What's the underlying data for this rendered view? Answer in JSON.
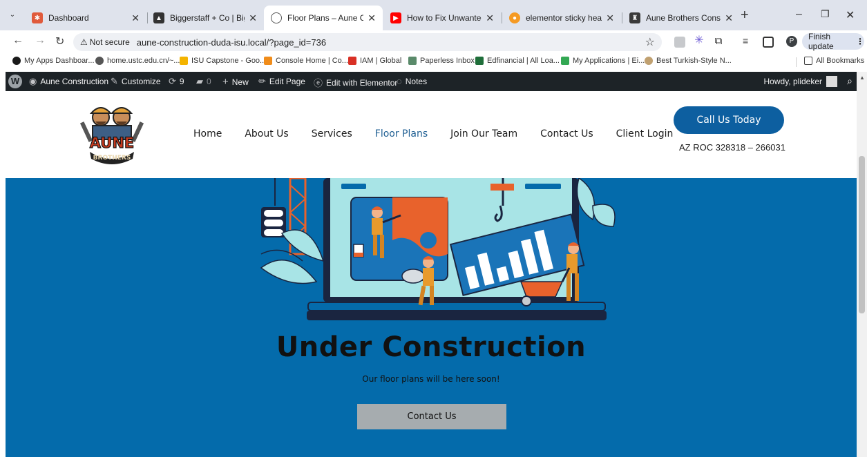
{
  "browser": {
    "tabs": [
      {
        "title": "Dashboard",
        "favicon_color": "#e05a3b",
        "active": false
      },
      {
        "title": "Biggerstaff + Co | Big Sky",
        "favicon_color": "#333333",
        "active": false
      },
      {
        "title": "Floor Plans – Aune Constru",
        "favicon_color": "#555555",
        "active": true
      },
      {
        "title": "How to Fix Unwanted Hori",
        "favicon_color": "#ff0000",
        "active": false
      },
      {
        "title": "elementor sticky header or",
        "favicon_color": "#f59a23",
        "active": false
      },
      {
        "title": "Aune Brothers Constructio",
        "favicon_color": "#3a3a3a",
        "active": false
      }
    ],
    "security_label": "Not secure",
    "url": "aune-construction-duda-isu.local/?page_id=736",
    "profile_initial": "P",
    "finish_update": "Finish update",
    "bookmarks": [
      {
        "label": "My Apps Dashboar...",
        "color": "#1a1a1a"
      },
      {
        "label": "home.ustc.edu.cn/~...",
        "color": "#555555"
      },
      {
        "label": "ISU Capstone - Goo...",
        "color": "#f4b400"
      },
      {
        "label": "Console Home | Co...",
        "color": "#f08c1a"
      },
      {
        "label": "IAM | Global",
        "color": "#d93025"
      },
      {
        "label": "Paperless Inbox",
        "color": "#5a8a6a"
      },
      {
        "label": "Edfinancial | All Loa...",
        "color": "#1f6e3a"
      },
      {
        "label": "My Applications | Ei...",
        "color": "#33a853"
      },
      {
        "label": "Best Turkish-Style N...",
        "color": "#c0a070"
      }
    ],
    "all_bookmarks": "All Bookmarks"
  },
  "wp_admin": {
    "site_name": "Aune Construction",
    "customize": "Customize",
    "updates_count": "9",
    "comments_count": "0",
    "new_label": "New",
    "edit_page": "Edit Page",
    "edit_elementor": "Edit with Elementor",
    "notes": "Notes",
    "howdy": "Howdy, plideker"
  },
  "site": {
    "logo_text_top": "AUNE",
    "logo_text_bottom": "BROTHERS",
    "nav": [
      "Home",
      "About Us",
      "Services",
      "Floor Plans",
      "Join Our Team",
      "Contact Us",
      "Client Login"
    ],
    "current_nav": "Floor Plans",
    "call_button": "Call Us Today",
    "roc_text": "AZ ROC 328318 – 266031"
  },
  "hero": {
    "title": "Under Construction",
    "subtitle": "Our floor plans will be here soon!",
    "button": "Contact Us",
    "background": "#046bab"
  }
}
